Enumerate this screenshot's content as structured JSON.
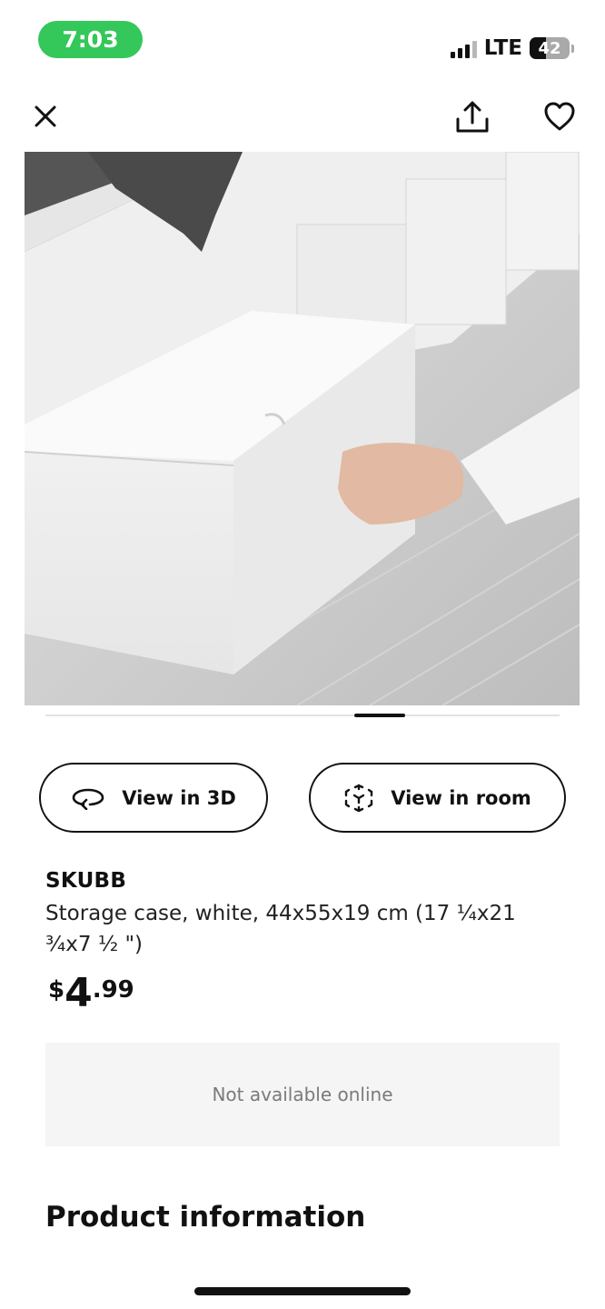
{
  "status_bar": {
    "time": "7:03",
    "network": "LTE",
    "battery": "42",
    "battery_level": 0.42,
    "time_pill_color": "#34c759"
  },
  "header": {
    "close_icon": "close-icon",
    "share_icon": "share-icon",
    "favorite_icon": "heart-icon"
  },
  "gallery": {
    "image_description_icon": "product-photo",
    "active_index_fraction": 0.65
  },
  "actions": {
    "view_3d_label": "View in 3D",
    "view_3d_icon": "rotate-icon",
    "view_room_label": "View in room",
    "view_room_icon": "ar-cube-icon"
  },
  "product": {
    "name": "SKUBB",
    "description": "Storage case, white, 44x55x19 cm (17 ¼x21 ¾x7 ½ \")",
    "price": {
      "currency": "$",
      "integer": "4",
      "decimal": ".99"
    },
    "availability": "Not available online"
  },
  "sections": {
    "product_information": "Product information"
  }
}
